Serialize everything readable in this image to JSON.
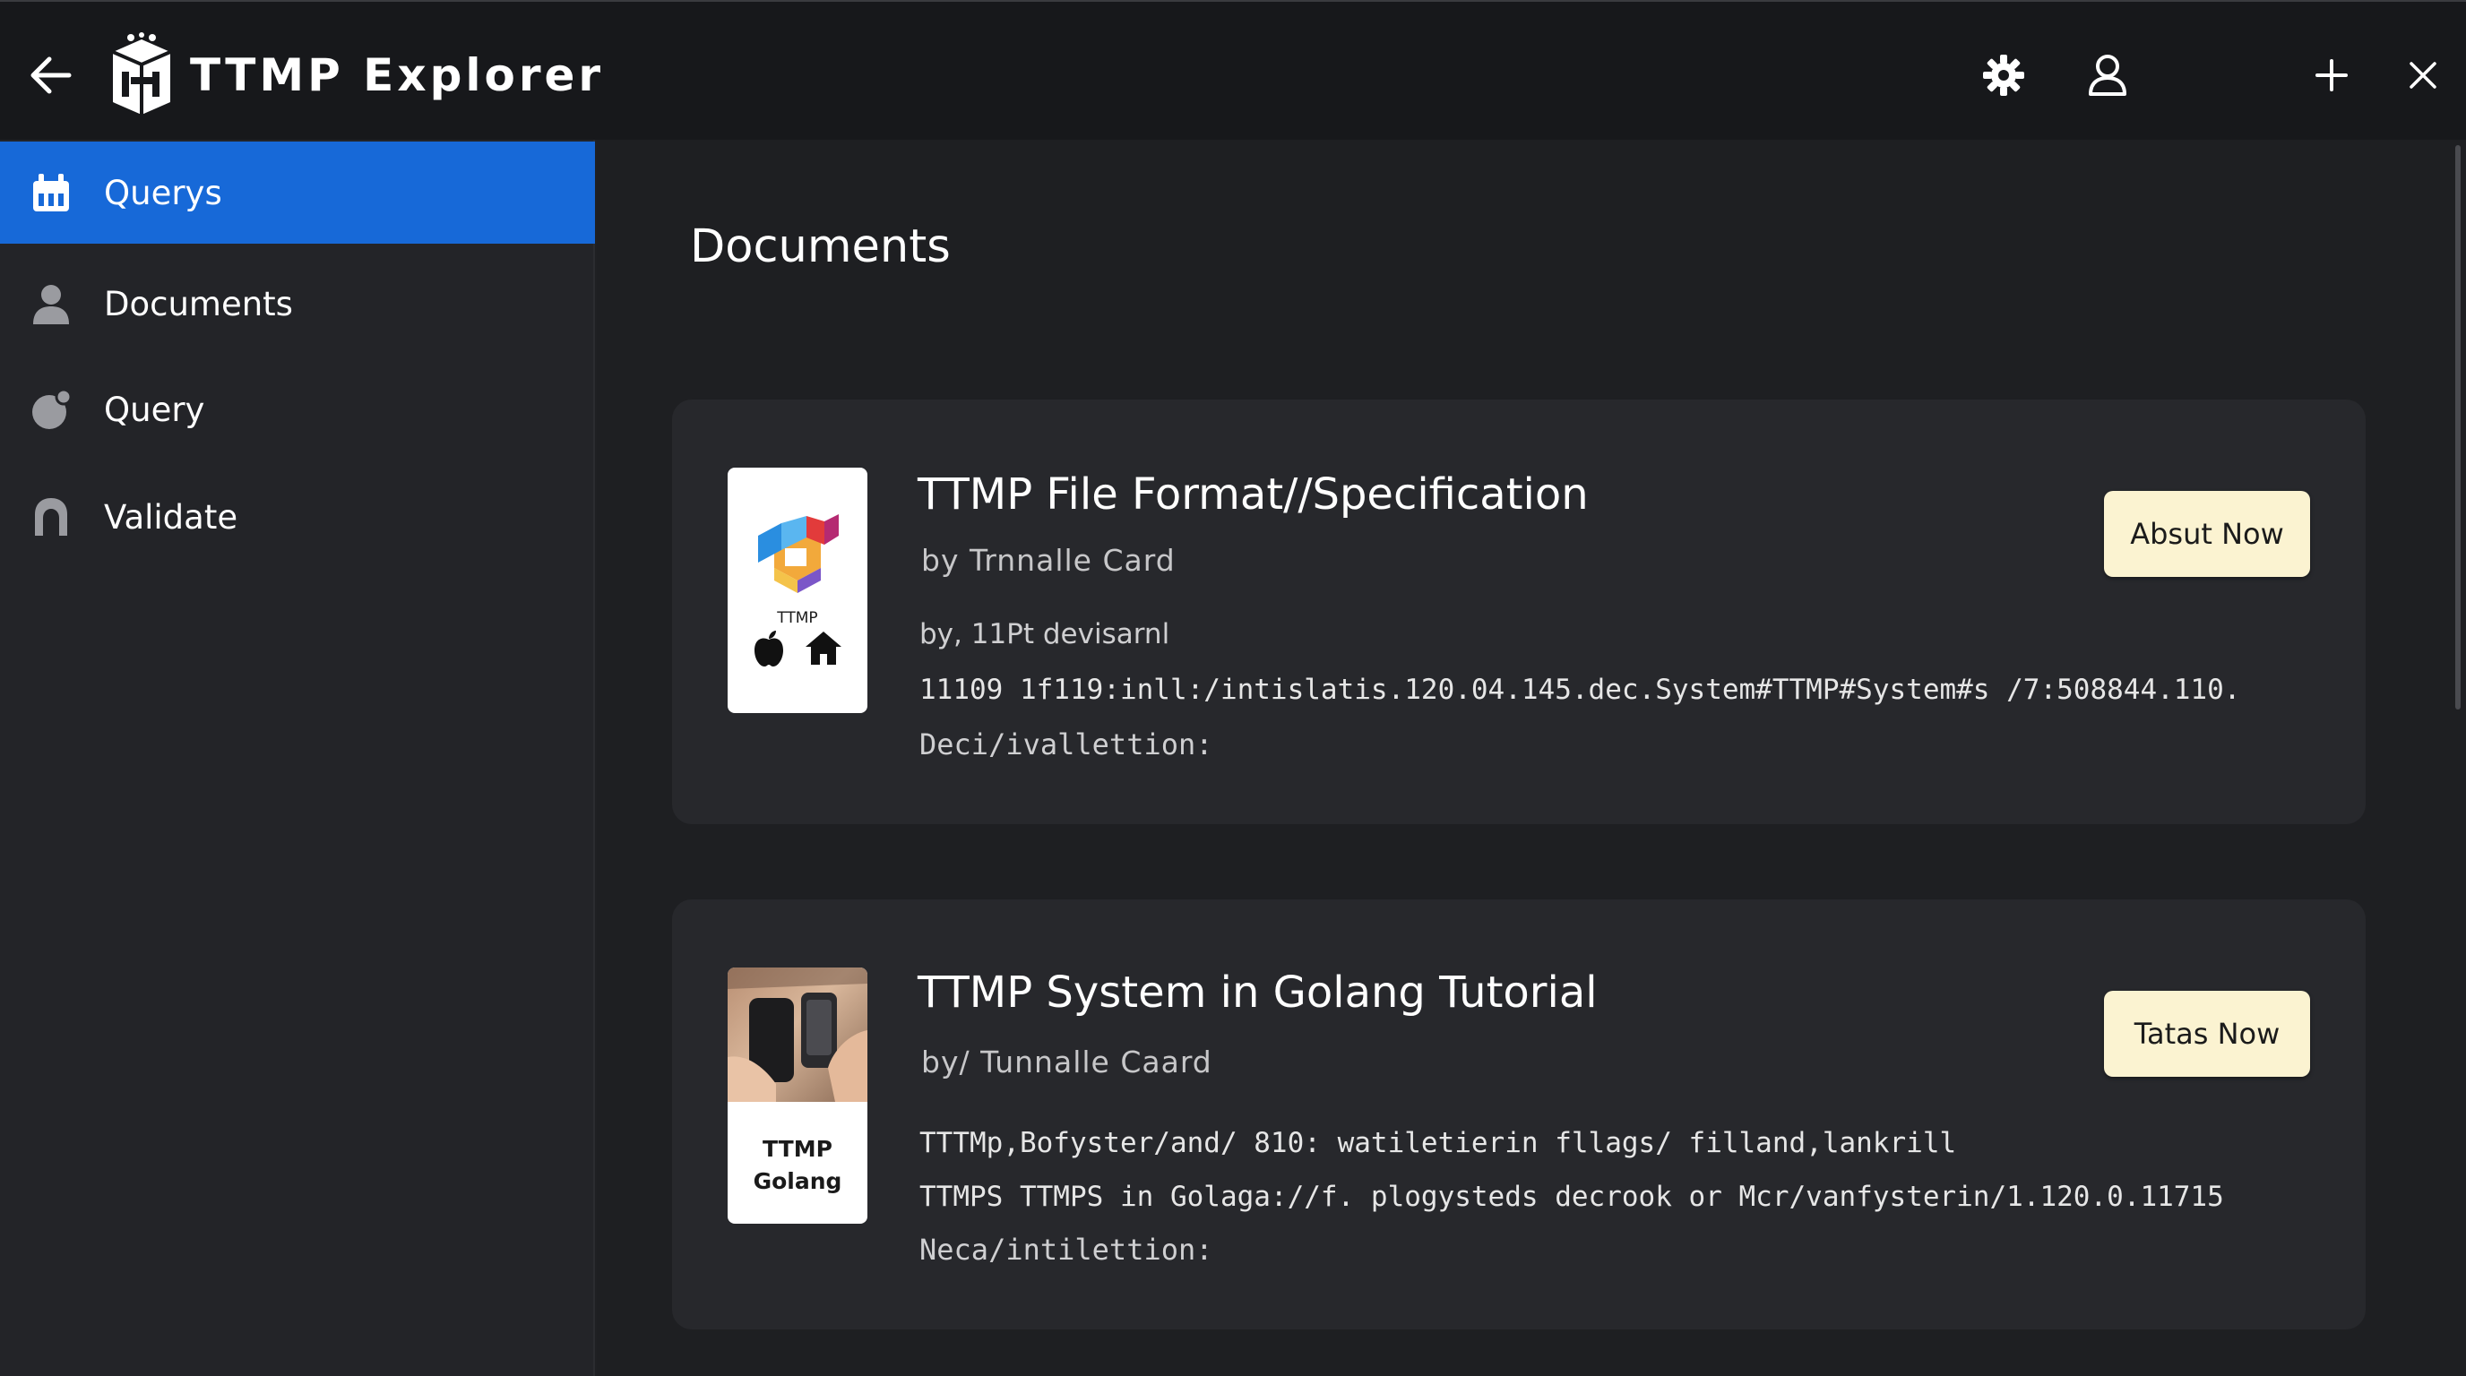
{
  "app": {
    "title": "TTMP Explorer",
    "accent": "#1769d8"
  },
  "titlebar": {
    "back_icon": "arrow-left-icon",
    "logo_icon": "ttmp-logo-icon",
    "buttons": [
      {
        "name": "settings",
        "icon": "gear-icon"
      },
      {
        "name": "account",
        "icon": "user-icon"
      },
      {
        "name": "add",
        "icon": "plus-icon"
      },
      {
        "name": "close",
        "icon": "close-icon"
      }
    ]
  },
  "sidebar": {
    "items": [
      {
        "label": "Querys",
        "icon": "calendar-icon",
        "active": true
      },
      {
        "label": "Documents",
        "icon": "person-icon",
        "active": false
      },
      {
        "label": "Query",
        "icon": "query-icon",
        "active": false
      },
      {
        "label": "Validate",
        "icon": "lock-icon",
        "active": false
      }
    ]
  },
  "main": {
    "title": "Documents",
    "cards": [
      {
        "title": "TTMP File Format//Specification",
        "author": "by Trnnalle Card",
        "lines": [
          "by, 11Pt devisarnl",
          "11109 1f119:inll:/intislatis.120.04.145.dec.System#TTMP#System#s /7:508844.110.",
          "Deci/ivallettion:"
        ],
        "button": "Absut Now",
        "thumb_label": "TTMP"
      },
      {
        "title": "TTMP System in Golang Tutorial",
        "author": "by/ Tunnalle Caard",
        "lines": [
          "TTTMp,Bofyster/and/ 810: watiletierin fllags/ filland,lankrill",
          "TTMPS TTMPS in Golaga://f. plogysteds decrook or Mcr/vanfysterin/1.120.0.11715",
          "Neca/intilettion:"
        ],
        "button": "Tatas Now",
        "thumb_label_1": "TTMP",
        "thumb_label_2": "Golang"
      }
    ]
  }
}
